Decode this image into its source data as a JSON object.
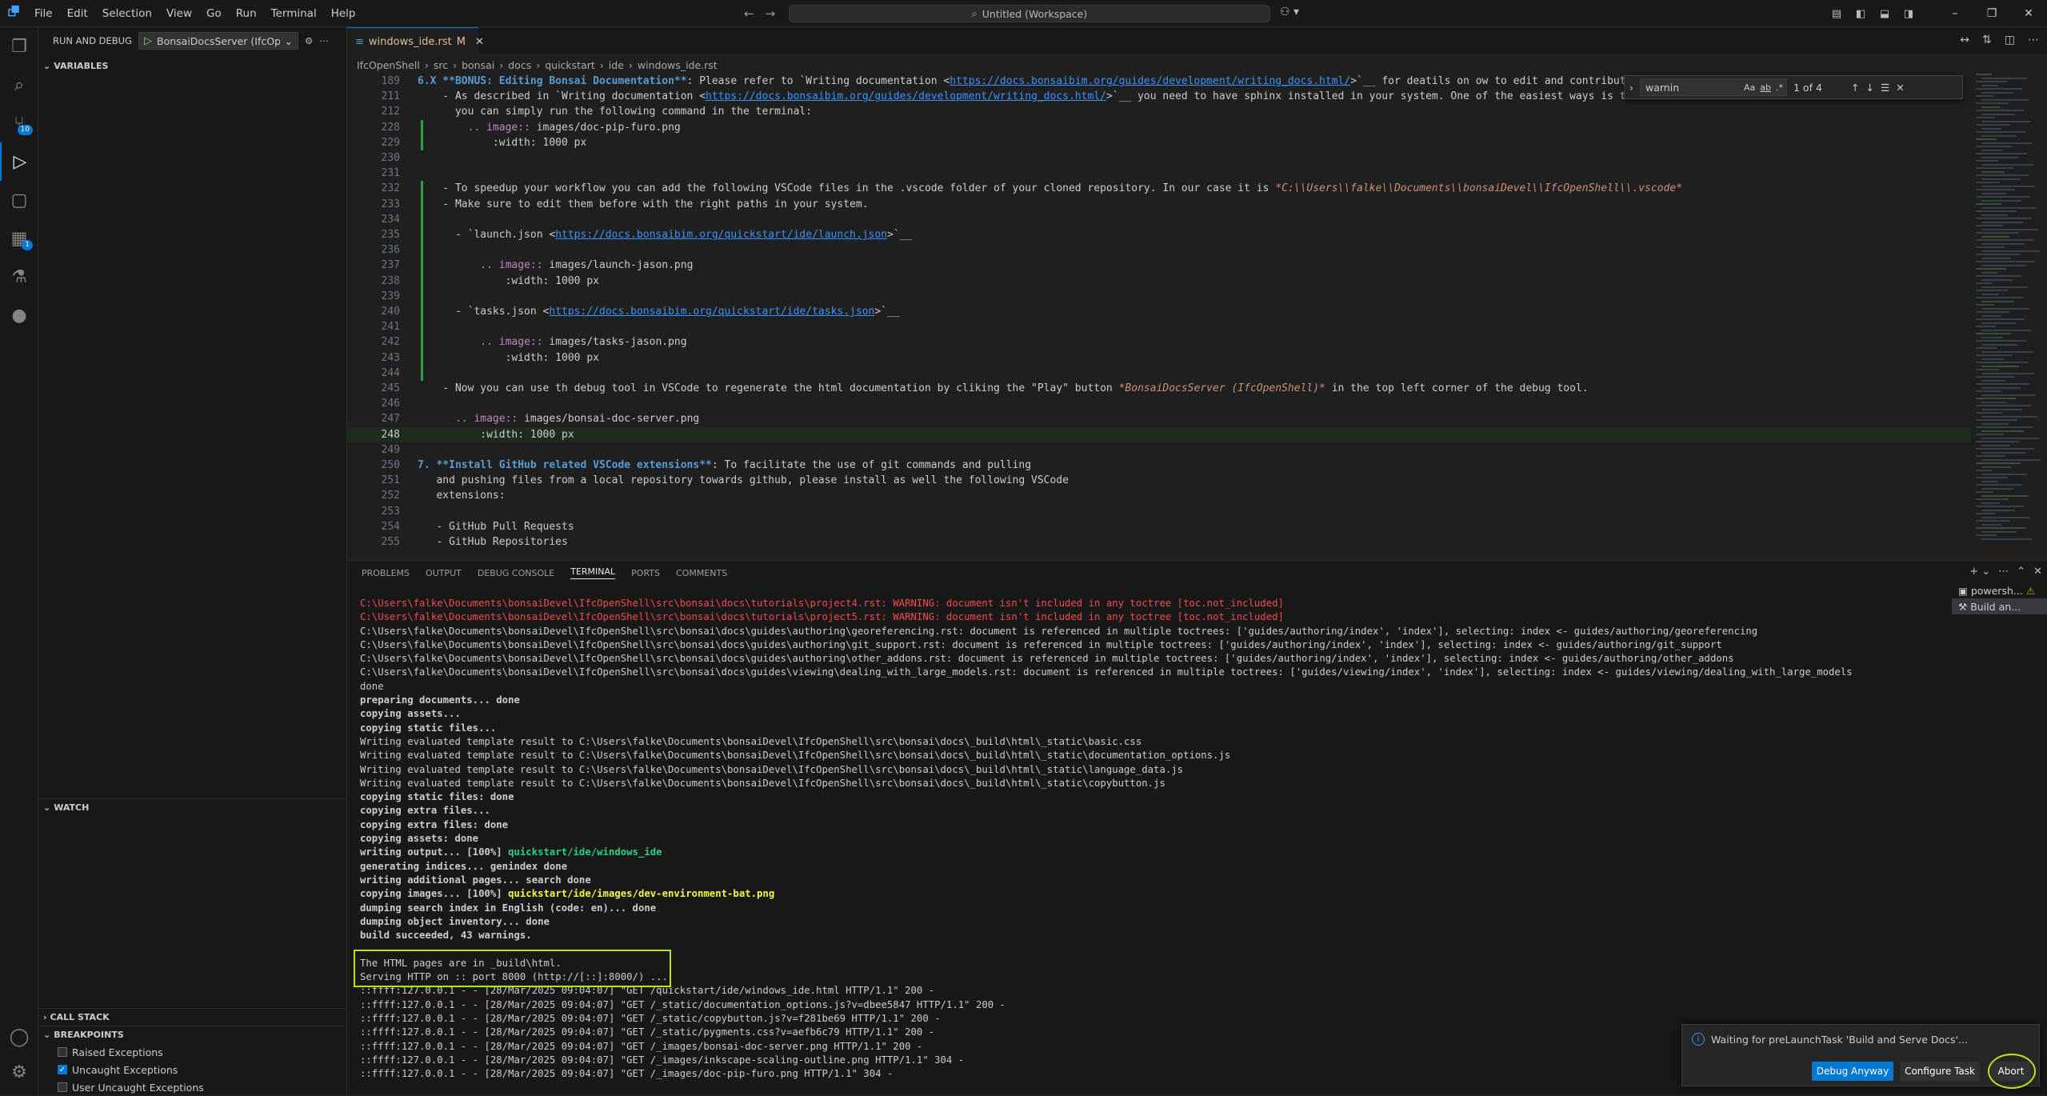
{
  "titlebar": {
    "menu": [
      "File",
      "Edit",
      "Selection",
      "View",
      "Go",
      "Run",
      "Terminal",
      "Help"
    ],
    "search": "Untitled (Workspace)",
    "icons": [
      "vscode-logo-icon",
      "back-arrow-icon",
      "forward-arrow-icon",
      "search-icon",
      "copilot-icon"
    ]
  },
  "activitybar": {
    "items": [
      {
        "name": "explorer-icon",
        "glyph": "❐"
      },
      {
        "name": "search-icon",
        "glyph": "⌕"
      },
      {
        "name": "source-control-icon",
        "glyph": "⑂",
        "badge": "10"
      },
      {
        "name": "run-debug-icon",
        "glyph": "▷"
      },
      {
        "name": "remote-explorer-icon",
        "glyph": "▢"
      },
      {
        "name": "extensions-icon",
        "glyph": "▦",
        "badge": "1"
      },
      {
        "name": "testing-icon",
        "glyph": "⚗"
      },
      {
        "name": "github-icon",
        "glyph": "●"
      }
    ]
  },
  "sidebar": {
    "title": "RUN AND DEBUG",
    "config": "BonsaiDocsServer (IfcOpen!",
    "variables": "VARIABLES",
    "watch": "WATCH",
    "callstack": "CALL STACK",
    "breakpoints": "BREAKPOINTS",
    "bp_items": [
      {
        "label": "Raised Exceptions",
        "checked": false
      },
      {
        "label": "Uncaught Exceptions",
        "checked": true
      },
      {
        "label": "User Uncaught Exceptions",
        "checked": false
      }
    ]
  },
  "tab": {
    "label": "windows_ide.rst",
    "status": "M"
  },
  "breadcrumb": [
    "IfcOpenShell",
    "src",
    "bonsai",
    "docs",
    "quickstart",
    "ide",
    "windows_ide.rst"
  ],
  "find": {
    "value": "warnin",
    "count": "1 of 4"
  },
  "editor_lines": [
    {
      "n": "189",
      "html": "<span class='sh'>6.X **BONUS: Editing Bonsai Documentation**</span>: Please refer to `Writing documentation &lt;<span class='lk'>https://docs.bonsaibim.org/guides/development/writing_docs.html/</span>&gt;`__ for deatils on ow to edit and contribute"
    },
    {
      "n": "211",
      "html": "    - As described in `Writing documentation &lt;<span class='lk'>https://docs.bonsaibim.org/guides/development/writing_docs.html/</span>&gt;`__ you need to have sphinx installed in your system. One of the easiest ways is to use `"
    },
    {
      "n": "212",
      "html": "      you can simply run the following command in the terminal:"
    },
    {
      "n": "228",
      "html": "        <span class='mg'>.. image::</span> images/doc-pip-furo.png"
    },
    {
      "n": "229",
      "html": "            :width: 1000 px"
    },
    {
      "n": "230",
      "html": ""
    },
    {
      "n": "231",
      "html": ""
    },
    {
      "n": "232",
      "html": "    - To speedup your workflow you can add the following VSCode files in the .vscode folder of your cloned repository. In our case it is <span class='em'>*C:\\\\Users\\\\falke\\\\Documents\\\\bonsaiDevel\\\\IfcOpenShell\\\\.vscode*</span>"
    },
    {
      "n": "233",
      "html": "    - Make sure to edit them before with the right paths in your system."
    },
    {
      "n": "234",
      "html": ""
    },
    {
      "n": "235",
      "html": "      - `launch.json &lt;<span class='lk'>https://docs.bonsaibim.org/quickstart/ide/launch.json</span>&gt;`__"
    },
    {
      "n": "236",
      "html": ""
    },
    {
      "n": "237",
      "html": "          <span class='mg'>.. image::</span> images/launch-jason.png"
    },
    {
      "n": "238",
      "html": "              :width: 1000 px"
    },
    {
      "n": "239",
      "html": ""
    },
    {
      "n": "240",
      "html": "      - `tasks.json &lt;<span class='lk'>https://docs.bonsaibim.org/quickstart/ide/tasks.json</span>&gt;`__"
    },
    {
      "n": "241",
      "html": ""
    },
    {
      "n": "242",
      "html": "          <span class='mg'>.. image::</span> images/tasks-jason.png"
    },
    {
      "n": "243",
      "html": "              :width: 1000 px"
    },
    {
      "n": "244",
      "html": ""
    },
    {
      "n": "245",
      "html": "    - Now you can use th debug tool in VSCode to regenerate the html documentation by cliking the \"Play\" button <span class='em'>*BonsaiDocsServer (IfcOpenShell)*</span> in the top left corner of the debug tool."
    },
    {
      "n": "246",
      "html": ""
    },
    {
      "n": "247",
      "html": "      <span class='mg'>.. image::</span> images/bonsai-doc-server.png"
    },
    {
      "n": "248",
      "html": "          :width: 1000 px"
    },
    {
      "n": "249",
      "html": ""
    },
    {
      "n": "250",
      "html": "<span class='sh'>7. **Install GitHub related VSCode extensions**</span>: To facilitate the use of git commands and pulling"
    },
    {
      "n": "251",
      "html": "   and pushing files from a local repository towards github, please install as well the following VSCode"
    },
    {
      "n": "252",
      "html": "   extensions:"
    },
    {
      "n": "253",
      "html": ""
    },
    {
      "n": "254",
      "html": "   - GitHub Pull Requests"
    },
    {
      "n": "255",
      "html": "   - GitHub Repositories"
    }
  ],
  "panel_tabs": [
    "PROBLEMS",
    "OUTPUT",
    "DEBUG CONSOLE",
    "TERMINAL",
    "PORTS",
    "COMMENTS"
  ],
  "terminal_instances": [
    "powersh...",
    "Build an..."
  ],
  "terminal_lines": [
    {
      "c": "red",
      "t": "C:\\Users\\falke\\Documents\\bonsaiDevel\\IfcOpenShell\\src\\bonsai\\docs\\tutorials\\project4.rst: WARNING: document isn't included in any toctree [toc.not_included]"
    },
    {
      "c": "red",
      "t": "C:\\Users\\falke\\Documents\\bonsaiDevel\\IfcOpenShell\\src\\bonsai\\docs\\tutorials\\project5.rst: WARNING: document isn't included in any toctree [toc.not_included]"
    },
    {
      "c": "",
      "t": "C:\\Users\\falke\\Documents\\bonsaiDevel\\IfcOpenShell\\src\\bonsai\\docs\\guides\\authoring\\georeferencing.rst: document is referenced in multiple toctrees: ['guides/authoring/index', 'index'], selecting: index <- guides/authoring/georeferencing"
    },
    {
      "c": "",
      "t": "C:\\Users\\falke\\Documents\\bonsaiDevel\\IfcOpenShell\\src\\bonsai\\docs\\guides\\authoring\\git_support.rst: document is referenced in multiple toctrees: ['guides/authoring/index', 'index'], selecting: index <- guides/authoring/git_support"
    },
    {
      "c": "",
      "t": "C:\\Users\\falke\\Documents\\bonsaiDevel\\IfcOpenShell\\src\\bonsai\\docs\\guides\\authoring\\other_addons.rst: document is referenced in multiple toctrees: ['guides/authoring/index', 'index'], selecting: index <- guides/authoring/other_addons"
    },
    {
      "c": "",
      "t": "C:\\Users\\falke\\Documents\\bonsaiDevel\\IfcOpenShell\\src\\bonsai\\docs\\guides\\viewing\\dealing_with_large_models.rst: document is referenced in multiple toctrees: ['guides/viewing/index', 'index'], selecting: index <- guides/viewing/dealing_with_large_models"
    },
    {
      "c": "",
      "t": "done"
    },
    {
      "c": "b",
      "t": "preparing documents... done"
    },
    {
      "c": "b",
      "t": "copying assets..."
    },
    {
      "c": "b",
      "t": "copying static files..."
    },
    {
      "c": "",
      "t": "Writing evaluated template result to C:\\Users\\falke\\Documents\\bonsaiDevel\\IfcOpenShell\\src\\bonsai\\docs\\_build\\html\\_static\\basic.css"
    },
    {
      "c": "",
      "t": "Writing evaluated template result to C:\\Users\\falke\\Documents\\bonsaiDevel\\IfcOpenShell\\src\\bonsai\\docs\\_build\\html\\_static\\documentation_options.js"
    },
    {
      "c": "",
      "t": "Writing evaluated template result to C:\\Users\\falke\\Documents\\bonsaiDevel\\IfcOpenShell\\src\\bonsai\\docs\\_build\\html\\_static\\language_data.js"
    },
    {
      "c": "",
      "t": "Writing evaluated template result to C:\\Users\\falke\\Documents\\bonsaiDevel\\IfcOpenShell\\src\\bonsai\\docs\\_build\\html\\_static\\copybutton.js"
    },
    {
      "c": "b",
      "t": "copying static files: done"
    },
    {
      "c": "b",
      "t": "copying extra files..."
    },
    {
      "c": "b",
      "t": "copying extra files: done"
    },
    {
      "c": "b",
      "t": "copying assets: done"
    },
    {
      "c": "b",
      "t": "writing output... [100%] ",
      "g": "quickstart/ide/windows_ide"
    },
    {
      "c": "b",
      "t": "generating indices... genindex done"
    },
    {
      "c": "b",
      "t": "writing additional pages... search done"
    },
    {
      "c": "b",
      "t": "copying images... [100%] ",
      "y": "quickstart/ide/images/dev-environment-bat.png"
    },
    {
      "c": "b",
      "t": "dumping search index in English (code: en)... done"
    },
    {
      "c": "b",
      "t": "dumping object inventory... done"
    },
    {
      "c": "b",
      "t": "build succeeded, 43 warnings."
    },
    {
      "c": "",
      "t": ""
    },
    {
      "c": "",
      "t": "The HTML pages are in _build\\html."
    },
    {
      "c": "",
      "t": "Serving HTTP on :: port 8000 (http://[::]:8000/) ..."
    },
    {
      "c": "",
      "t": "::ffff:127.0.0.1 - - [28/Mar/2025 09:04:07] \"GET /quickstart/ide/windows_ide.html HTTP/1.1\" 200 -"
    },
    {
      "c": "",
      "t": "::ffff:127.0.0.1 - - [28/Mar/2025 09:04:07] \"GET /_static/documentation_options.js?v=dbee5847 HTTP/1.1\" 200 -"
    },
    {
      "c": "",
      "t": "::ffff:127.0.0.1 - - [28/Mar/2025 09:04:07] \"GET /_static/copybutton.js?v=f281be69 HTTP/1.1\" 200 -"
    },
    {
      "c": "",
      "t": "::ffff:127.0.0.1 - - [28/Mar/2025 09:04:07] \"GET /_static/pygments.css?v=aefb6c79 HTTP/1.1\" 200 -"
    },
    {
      "c": "",
      "t": "::ffff:127.0.0.1 - - [28/Mar/2025 09:04:07] \"GET /_images/bonsai-doc-server.png HTTP/1.1\" 200 -"
    },
    {
      "c": "",
      "t": "::ffff:127.0.0.1 - - [28/Mar/2025 09:04:07] \"GET /_images/inkscape-scaling-outline.png HTTP/1.1\" 304 -"
    },
    {
      "c": "",
      "t": "::ffff:127.0.0.1 - - [28/Mar/2025 09:04:07] \"GET /_images/doc-pip-furo.png HTTP/1.1\" 304 -"
    }
  ],
  "toast": {
    "message": "Waiting for preLaunchTask 'Build and Serve Docs'...",
    "debug_anyway": "Debug Anyway",
    "configure_task": "Configure Task",
    "abort": "Abort"
  },
  "colors": {
    "accent": "#0078d4",
    "highlight_box": "#b5e61d",
    "warning": "#f14c4c"
  }
}
